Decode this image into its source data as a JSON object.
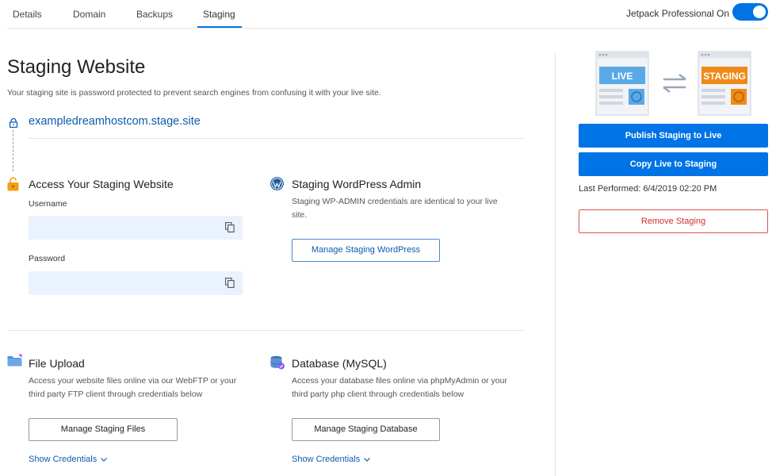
{
  "tabs": [
    {
      "label": "Details"
    },
    {
      "label": "Domain"
    },
    {
      "label": "Backups"
    },
    {
      "label": "Staging"
    }
  ],
  "jetpack": {
    "label": "Jetpack Professional On",
    "enabled": true
  },
  "main": {
    "title": "Staging Website",
    "description": "Your staging site is password protected to prevent search engines from confusing it with your live site.",
    "site_url": "exampledreamhostcom.stage.site"
  },
  "access": {
    "title": "Access Your Staging Website",
    "username_label": "Username",
    "username_value": "",
    "password_label": "Password",
    "password_value": ""
  },
  "wp_admin": {
    "title": "Staging WordPress Admin",
    "description_line1": "Staging WP-ADMIN credentials are identical to your live",
    "description_line2": "site.",
    "button": "Manage Staging WordPress"
  },
  "file_upload": {
    "title": "File Upload",
    "description_line1": "Access your website files online via our WebFTP or your",
    "description_line2": "third party FTP client through credentials below",
    "button": "Manage Staging Files",
    "show_credentials": "Show Credentials"
  },
  "database": {
    "title": "Database (MySQL)",
    "description_line1": "Access your database files online via phpMyAdmin or your",
    "description_line2": "third party php client through credentials below",
    "button": "Manage Staging Database",
    "show_credentials": "Show Credentials"
  },
  "sidebar": {
    "live_label": "LIVE",
    "staging_label": "STAGING",
    "publish_button": "Publish Staging to Live",
    "copy_button": "Copy Live to Staging",
    "last_performed": "Last Performed: 6/4/2019 02:20 PM",
    "remove_button": "Remove Staging"
  },
  "colors": {
    "accent": "#0073e6",
    "link": "#0b5cad",
    "danger": "#d32f2f",
    "staging_orange": "#ef8a1a",
    "live_blue": "#5aa9e6"
  }
}
